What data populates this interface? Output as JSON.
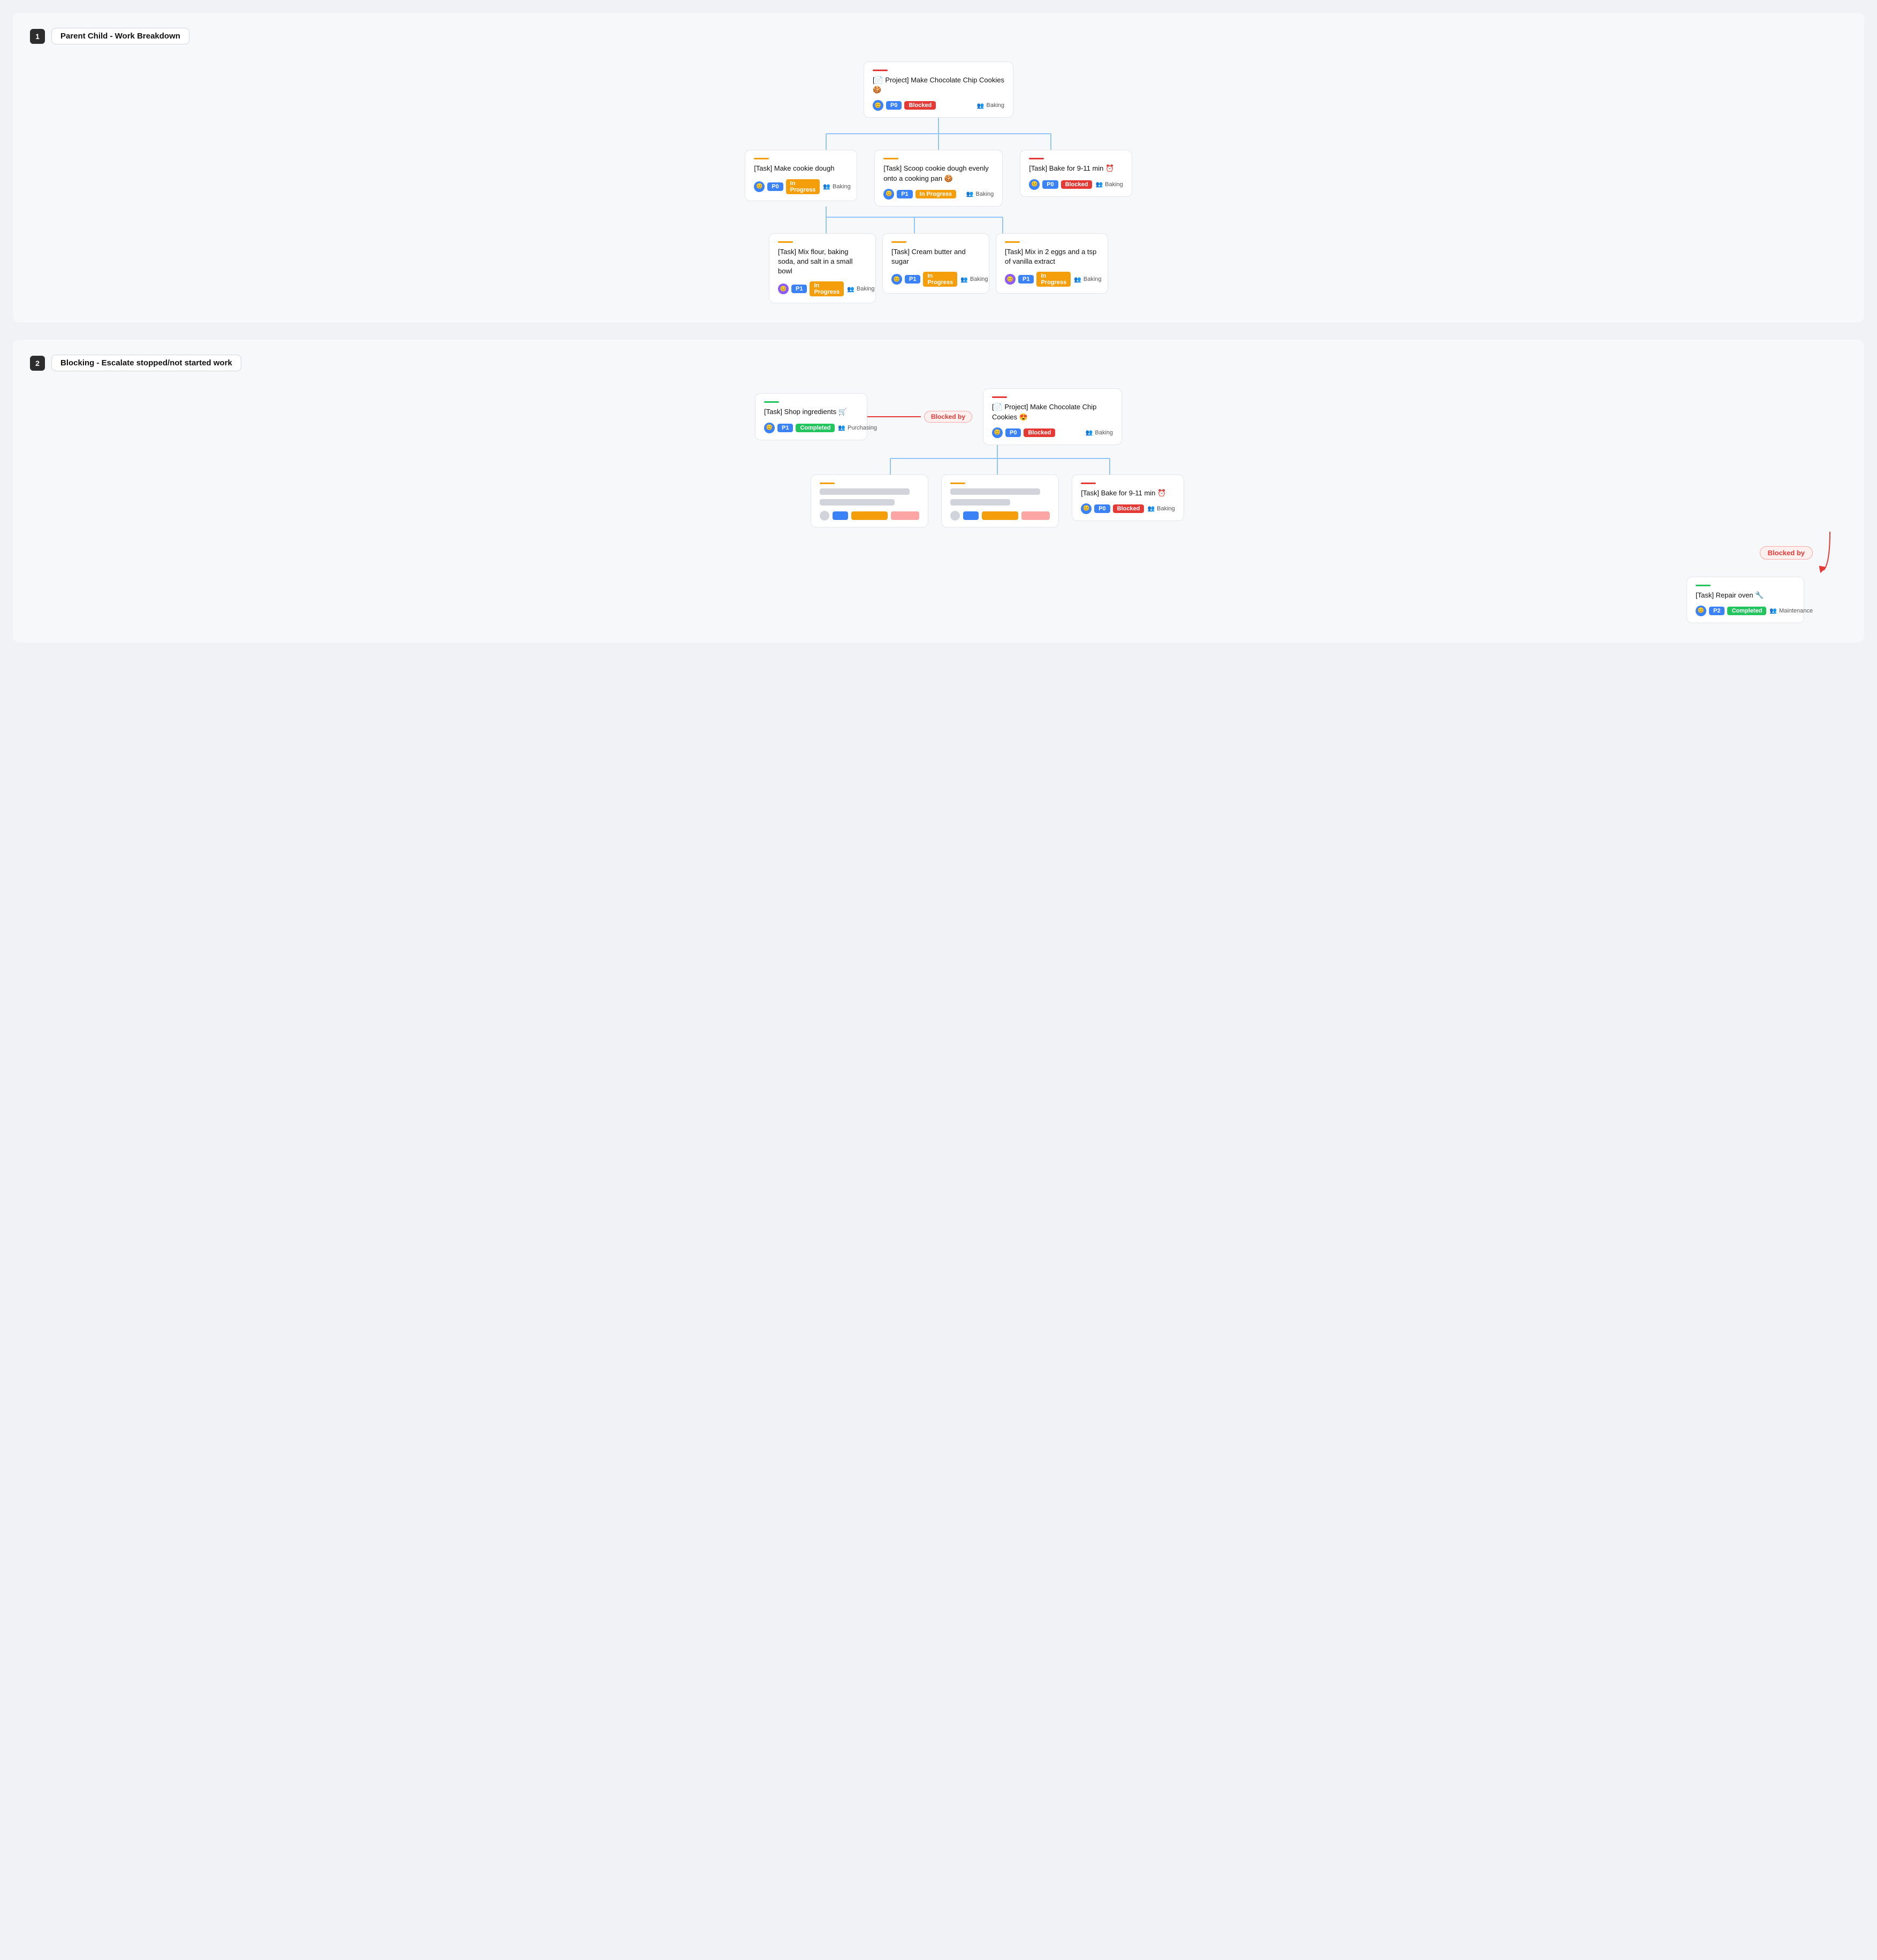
{
  "section1": {
    "number": "1",
    "title": "Parent Child - Work Breakdown",
    "root": {
      "accent": "accent-red",
      "title": "[📄 Project] Make Chocolate Chip Cookies 🍪",
      "priority": "P0",
      "status": "Blocked",
      "statusClass": "badge-blocked",
      "team": "Baking"
    },
    "level2": [
      {
        "accent": "accent-orange",
        "title": "[Task] Make cookie dough",
        "priority": "P0",
        "status": "In Progress",
        "statusClass": "badge-inprogress",
        "team": "Baking"
      },
      {
        "accent": "accent-orange",
        "title": "[Task] Scoop cookie dough evenly onto a cooking pan 🍪",
        "priority": "P1",
        "status": "In Progress",
        "statusClass": "badge-inprogress",
        "team": "Baking"
      },
      {
        "accent": "accent-red",
        "title": "[Task] Bake for 9-11 min ⏰",
        "priority": "P0",
        "status": "Blocked",
        "statusClass": "badge-blocked",
        "team": "Baking"
      }
    ],
    "level3": [
      {
        "accent": "accent-orange",
        "title": "[Task] Mix flour, baking soda, and salt in a small bowl",
        "priority": "P1",
        "status": "In Progress",
        "statusClass": "badge-inprogress",
        "team": "Baking"
      },
      {
        "accent": "accent-orange",
        "title": "[Task] Cream butter and sugar",
        "priority": "P1",
        "status": "In Progress",
        "statusClass": "badge-inprogress",
        "team": "Baking"
      },
      {
        "accent": "accent-orange",
        "title": "[Task] Mix in 2 eggs and a tsp of vanilla extract",
        "priority": "P1",
        "status": "In Progress",
        "statusClass": "badge-inprogress",
        "team": "Baking"
      }
    ]
  },
  "section2": {
    "number": "2",
    "title": "Blocking - Escalate stopped/not started work",
    "shopCard": {
      "accent": "accent-green",
      "title": "[Task] Shop ingredients 🛒",
      "priority": "P1",
      "status": "Completed",
      "statusClass": "badge-completed",
      "team": "Purchasing"
    },
    "blockedByLabel1": "Blocked by",
    "projectCard": {
      "accent": "accent-red",
      "title": "[📄 Project] Make Chocolate Chip Cookies 😍",
      "priority": "P0",
      "status": "Blocked",
      "statusClass": "badge-blocked",
      "team": "Baking"
    },
    "bakeCard": {
      "accent": "accent-red",
      "title": "[Task] Bake for 9-11 min ⏰",
      "priority": "P0",
      "status": "Blocked",
      "statusClass": "badge-blocked",
      "team": "Baking"
    },
    "blockedByLabel2": "Blocked by",
    "repairCard": {
      "accent": "accent-green",
      "title": "[Task] Repair oven 🔧",
      "priority": "P2",
      "status": "Completed",
      "statusClass": "badge-completed",
      "team": "Maintenance"
    }
  }
}
